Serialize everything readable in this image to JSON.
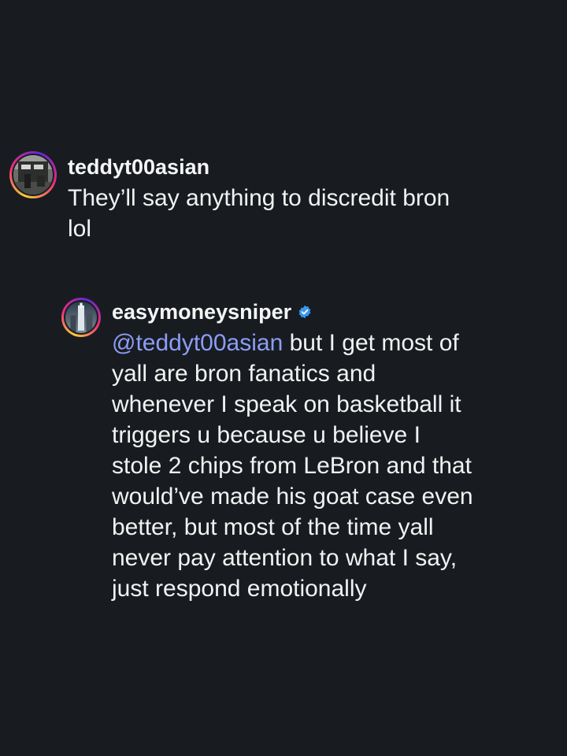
{
  "comments": [
    {
      "username": "teddyt00asian",
      "verified": false,
      "text": "They’ll say anything to discredit bron\nlol"
    },
    {
      "username": "easymoneysniper",
      "verified": true,
      "mention": "@teddyt00asian",
      "text": " but I get most of\nyall are bron fanatics and\nwhenever I speak on basketball it\ntriggers u because u believe I\nstole 2 chips from LeBron and that\nwould’ve made his goat case even\nbetter, but most of the time yall\nnever pay attention to what I say,\njust respond emotionally"
    }
  ],
  "colors": {
    "background": "#181c21",
    "mention": "#8c9df5",
    "verified_badge": "#3897f0"
  },
  "icons": {
    "verified": "verified-badge-icon"
  }
}
